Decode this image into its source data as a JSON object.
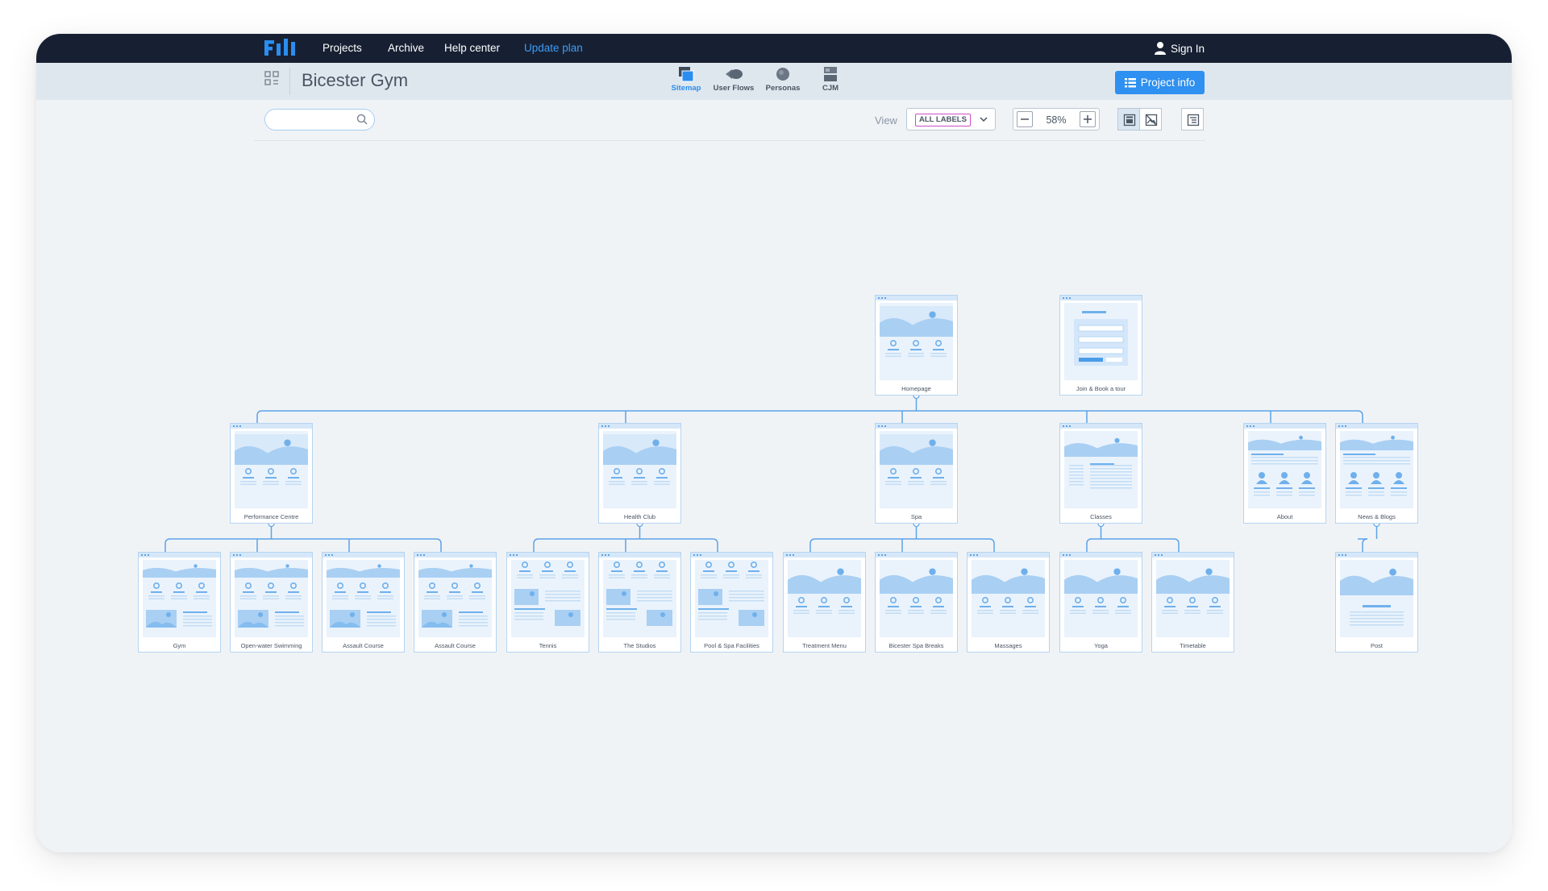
{
  "app": {
    "nav": {
      "projects": "Projects",
      "archive": "Archive",
      "help": "Help center",
      "update": "Update plan",
      "signin": "Sign In"
    },
    "project_title": "Bicester Gym",
    "tabs": [
      {
        "label": "Sitemap"
      },
      {
        "label": "User Flows"
      },
      {
        "label": "Personas"
      },
      {
        "label": "CJM"
      }
    ],
    "active_tab": "Sitemap",
    "project_info": "Project info",
    "search": {
      "placeholder": "",
      "value": ""
    },
    "view": {
      "label": "View",
      "selected": "ALL LABELS"
    },
    "zoom": {
      "value": "58%"
    },
    "colors": {
      "topbar": "#172033",
      "accent": "#2e90f0",
      "update_link": "#3d9cf5",
      "chip_border": "#cc4dc6",
      "connector": "#5aa3e8"
    }
  },
  "sitemap": {
    "pages": [
      {
        "label": "Homepage",
        "variant": "hero",
        "level": 0
      },
      {
        "label": "Join & Book a tour",
        "variant": "form",
        "level": 0
      },
      {
        "label": "Performance Centre",
        "variant": "hero",
        "level": 1
      },
      {
        "label": "Health Club",
        "variant": "hero",
        "level": 1
      },
      {
        "label": "Spa",
        "variant": "hero",
        "level": 1
      },
      {
        "label": "Classes",
        "variant": "text",
        "level": 1
      },
      {
        "label": "About",
        "variant": "people",
        "level": 1
      },
      {
        "label": "News & Blogs",
        "variant": "people",
        "level": 1
      },
      {
        "label": "Gym",
        "variant": "mixed",
        "level": 2
      },
      {
        "label": "Open-water Swimming",
        "variant": "mixed",
        "level": 2
      },
      {
        "label": "Assault Course",
        "variant": "mixed",
        "level": 2
      },
      {
        "label": "Assault Course",
        "variant": "mixed",
        "level": 2
      },
      {
        "label": "Tennis",
        "variant": "mixed2",
        "level": 2
      },
      {
        "label": "The Studios",
        "variant": "mixed2",
        "level": 2
      },
      {
        "label": "Pool & Spa Facilities",
        "variant": "mixed2",
        "level": 2
      },
      {
        "label": "Treatment Menu",
        "variant": "hero2",
        "level": 2
      },
      {
        "label": "Bicester Spa Breaks",
        "variant": "hero2",
        "level": 2
      },
      {
        "label": "Massages",
        "variant": "hero2",
        "level": 2
      },
      {
        "label": "Yoga",
        "variant": "hero2",
        "level": 2
      },
      {
        "label": "Timetable",
        "variant": "hero2",
        "level": 2
      },
      {
        "label": "Post",
        "variant": "post",
        "level": 2
      }
    ]
  }
}
